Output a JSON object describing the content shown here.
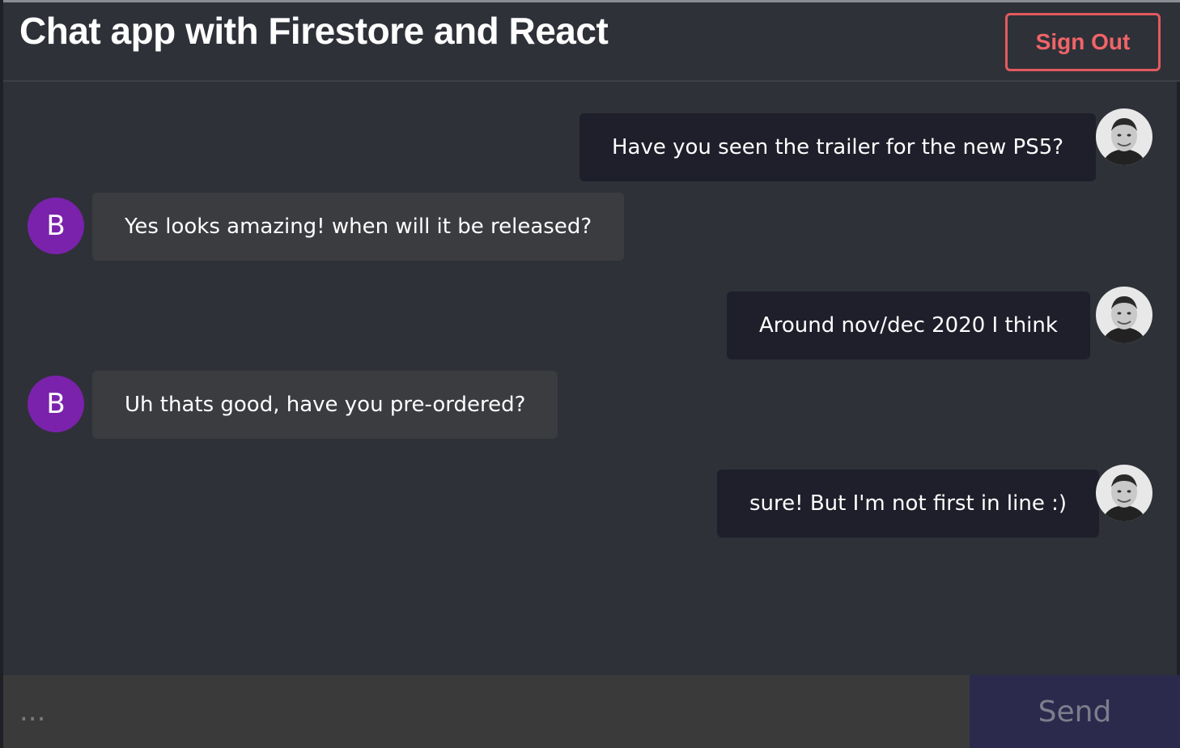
{
  "header": {
    "title": "Chat app with Firestore and React",
    "sign_out_label": "Sign Out"
  },
  "messages": [
    {
      "type": "sent",
      "text": "Have you seen the trailer for the new PS5?",
      "avatar": "user-photo"
    },
    {
      "type": "received",
      "text": "Yes looks amazing! when will it be released?",
      "avatar_letter": "B"
    },
    {
      "type": "sent",
      "text": "Around nov/dec 2020 I think",
      "avatar": "user-photo"
    },
    {
      "type": "received",
      "text": "Uh thats good, have you pre-ordered?",
      "avatar_letter": "B"
    },
    {
      "type": "sent",
      "text": "sure! But I'm not first in line :)",
      "avatar": "user-photo"
    }
  ],
  "composer": {
    "placeholder": "...",
    "value": "",
    "send_label": "Send"
  },
  "colors": {
    "background": "#2e3138",
    "sent_bubble": "#1e1f2a",
    "received_bubble": "#3b3c40",
    "avatar_purple": "#7a22ac",
    "sign_out_accent": "#e35a5f",
    "send_button": "#2b2a4d"
  }
}
